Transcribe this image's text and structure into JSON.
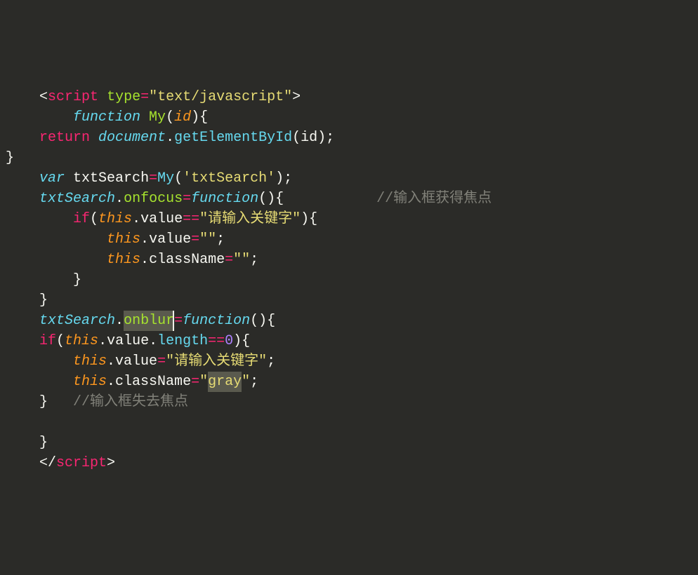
{
  "code": {
    "line1_open_tag": "<",
    "line1_script": "script",
    "line1_sp": " ",
    "line1_type_attr": "type",
    "line1_eq": "=",
    "line1_type_val": "\"text/javascript\"",
    "line1_close": ">",
    "line2_indent": "        ",
    "line2_function": "function",
    "line2_sp": " ",
    "line2_my": "My",
    "line2_paren_o": "(",
    "line2_id": "id",
    "line2_paren_c_brace": "){",
    "line3_indent": "    ",
    "line3_return": "return",
    "line3_sp": " ",
    "line3_document": "document",
    "line3_dot": ".",
    "line3_gebi": "getElementById",
    "line3_po": "(",
    "line3_id": "id",
    "line3_pc_semi": ");",
    "line4_brace": "}",
    "line5_indent": "    ",
    "line5_var": "var",
    "line5_sp": " ",
    "line5_txtSearch_decl": "txtSearch",
    "line5_eq": "=",
    "line5_my": "My",
    "line5_po": "(",
    "line5_str": "'txtSearch'",
    "line5_pc_semi": ");",
    "line6_indent": "    ",
    "line6_txtSearch": "txtSearch",
    "line6_dot": ".",
    "line6_onfocus": "onfocus",
    "line6_eq": "=",
    "line6_function": "function",
    "line6_po": "(",
    "line6_pc_brace": "){",
    "line6_spaces": "           ",
    "line6_comment": "//输入框获得焦点",
    "line7_indent": "        ",
    "line7_if": "if",
    "line7_po": "(",
    "line7_this": "this",
    "line7_dot": ".",
    "line7_value": "value",
    "line7_eqeq": "==",
    "line7_str": "\"请输入关键字\"",
    "line7_pc_brace": "){",
    "line8_indent": "            ",
    "line8_this": "this",
    "line8_dot": ".",
    "line8_value": "value",
    "line8_eq": "=",
    "line8_str": "\"\"",
    "line8_semi": ";",
    "line9_indent": "            ",
    "line9_this": "this",
    "line9_dot": ".",
    "line9_className": "className",
    "line9_eq": "=",
    "line9_str": "\"\"",
    "line9_semi": ";",
    "line10_indent": "        ",
    "line10_brace": "}",
    "line11_indent": "    ",
    "line11_brace": "}",
    "line12_indent": "    ",
    "line12_txtSearch": "txtSearch",
    "line12_dot": ".",
    "line12_onblur": "onblur",
    "line12_eq": "=",
    "line12_function": "function",
    "line12_po": "(",
    "line12_pc_brace": "){",
    "line13_indent": "    ",
    "line13_if": "if",
    "line13_po": "(",
    "line13_this": "this",
    "line13_dot": ".",
    "line13_value": "value",
    "line13_dot2": ".",
    "line13_length": "length",
    "line13_eqeq": "==",
    "line13_zero": "0",
    "line13_pc_brace": "){",
    "line14_indent": "        ",
    "line14_this": "this",
    "line14_dot": ".",
    "line14_value": "value",
    "line14_eq": "=",
    "line14_str": "\"请输入关键字\"",
    "line14_semi": ";",
    "line15_indent": "        ",
    "line15_this": "this",
    "line15_dot": ".",
    "line15_className": "className",
    "line15_eq": "=",
    "line15_q1": "\"",
    "line15_gray": "gray",
    "line15_q2": "\"",
    "line15_semi": ";",
    "line16_indent": "    ",
    "line16_brace": "}",
    "line16_sp": "   ",
    "line16_comment": "//输入框失去焦点",
    "line17_blank": "",
    "line18_indent": "    ",
    "line18_brace": "}",
    "line19_indent": "    ",
    "line19_open": "</",
    "line19_script": "script",
    "line19_close": ">"
  }
}
